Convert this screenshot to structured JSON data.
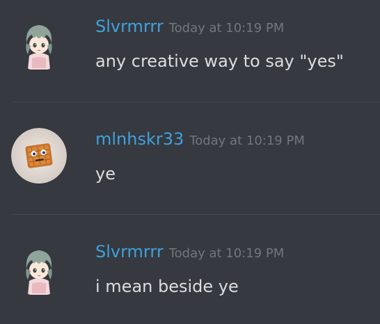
{
  "messages": [
    {
      "username": "Slvrmrrr",
      "timestamp": "Today at 10:19 PM",
      "text": "any creative way to say \"yes\"",
      "avatar_icon": "anime-chibi-green-hair-avatar"
    },
    {
      "username": "mlnhskr33",
      "timestamp": "Today at 10:19 PM",
      "text": "ye",
      "avatar_icon": "cereal-square-face-avatar"
    },
    {
      "username": "Slvrmrrr",
      "timestamp": "Today at 10:19 PM",
      "text": "i mean beside ye",
      "avatar_icon": "anime-chibi-green-hair-avatar"
    }
  ],
  "colors": {
    "background": "#36393f",
    "username": "#3fa1dd",
    "timestamp": "#72767d",
    "text": "#dcddde",
    "divider": "#44474d"
  }
}
